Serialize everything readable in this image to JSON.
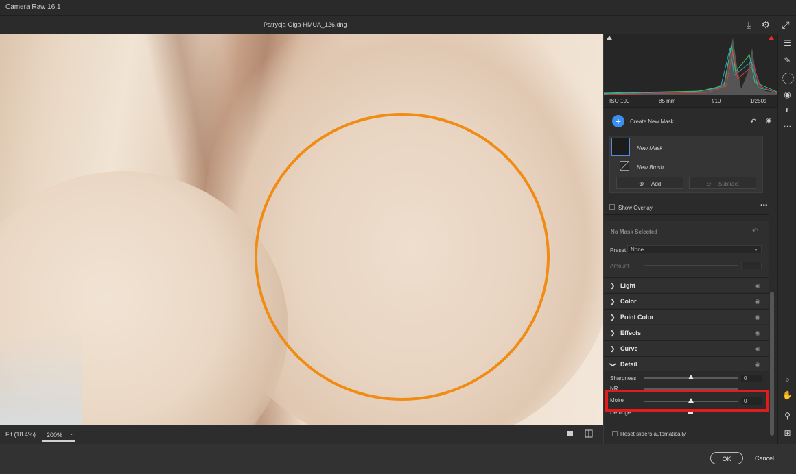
{
  "app": {
    "title": "Camera Raw 16.1"
  },
  "file": {
    "name": "Patrycja-Olga-HMUA_126.dng"
  },
  "camera": {
    "iso": "ISO 100",
    "focal": "85 mm",
    "aperture": "f/10",
    "shutter": "1/250s"
  },
  "masking": {
    "create_label": "Create New Mask",
    "mask_name": "New Mask",
    "brush_name": "New Brush",
    "add_label": "Add",
    "subtract_label": "Subtract",
    "show_overlay": "Show Overlay",
    "no_mask": "No Mask Selected",
    "preset_label": "Preset",
    "preset_value": "None",
    "amount_label": "Amount"
  },
  "sections": [
    {
      "label": "Light",
      "expanded": false
    },
    {
      "label": "Color",
      "expanded": false
    },
    {
      "label": "Point Color",
      "expanded": false
    },
    {
      "label": "Effects",
      "expanded": false
    },
    {
      "label": "Curve",
      "expanded": false
    },
    {
      "label": "Detail",
      "expanded": true
    }
  ],
  "detail": {
    "sharpness": {
      "label": "Sharpness",
      "value": "0"
    },
    "nr": {
      "label": "NR",
      "value": ""
    },
    "moire": {
      "label": "Moire",
      "value": "0"
    },
    "defringe": {
      "label": "Defringe",
      "value": ""
    },
    "reset_label": "Reset sliders automatically"
  },
  "view": {
    "fit_label": "Fit (18.4%)",
    "zoom_label": "200%"
  },
  "footer": {
    "ok_label": "OK",
    "cancel_label": "Cancel"
  },
  "colors": {
    "accent": "#3a8ef0",
    "highlight_circle": "#f08c14",
    "annotation_box": "#e41b1b"
  },
  "icons": [
    "save-icon",
    "settings-icon",
    "fullscreen-icon",
    "edit-sliders-icon",
    "healing-icon",
    "masking-icon",
    "redeye-icon",
    "presets-icon",
    "more-icon",
    "zoom-icon",
    "hand-icon",
    "color-sampler-icon",
    "grid-icon"
  ]
}
